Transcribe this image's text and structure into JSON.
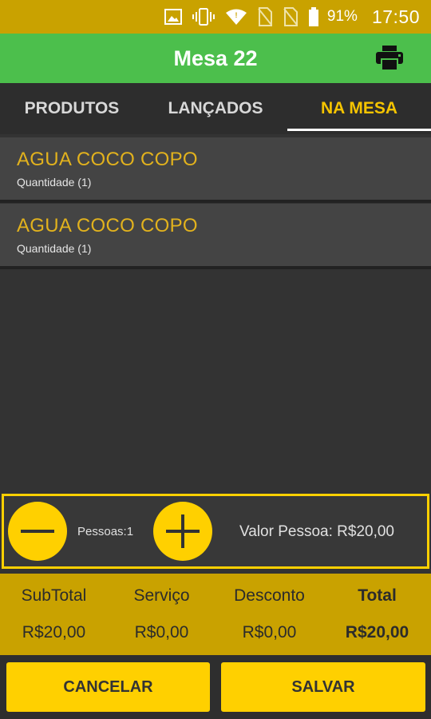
{
  "status_bar": {
    "battery_percent": "91%",
    "time": "17:50",
    "icons": [
      "image-icon",
      "vibrate-icon",
      "wifi-icon",
      "no-sim-icon",
      "no-sim-icon",
      "battery-icon"
    ]
  },
  "app_bar": {
    "title": "Mesa 22",
    "action_icon": "print-icon"
  },
  "tabs": [
    {
      "label": "PRODUTOS",
      "active": false
    },
    {
      "label": "LANÇADOS",
      "active": false
    },
    {
      "label": "NA MESA",
      "active": true
    }
  ],
  "items": [
    {
      "name": "AGUA COCO COPO",
      "quantity": "Quantidade (1)"
    },
    {
      "name": "AGUA COCO COPO",
      "quantity": "Quantidade (1)"
    }
  ],
  "people": {
    "label": "Pessoas:1",
    "valor_pessoa": "Valor Pessoa: R$20,00"
  },
  "totals": {
    "subtotal_label": "SubTotal",
    "subtotal_value": "R$20,00",
    "servico_label": "Serviço",
    "servico_value": "R$0,00",
    "desconto_label": "Desconto",
    "desconto_value": "R$0,00",
    "total_label": "Total",
    "total_value": "R$20,00"
  },
  "actions": {
    "cancel_label": "CANCELAR",
    "save_label": "SALVAR"
  },
  "colors": {
    "status_bar": "#C9A200",
    "app_bar": "#4CBF4C",
    "accent": "#FFD000",
    "item_text": "#E2B21D",
    "background": "#333333"
  }
}
